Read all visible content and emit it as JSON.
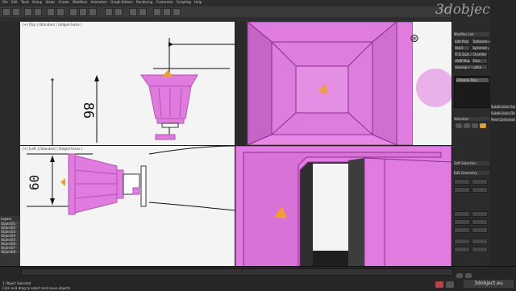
{
  "menubar": {
    "items": [
      "File",
      "Edit",
      "Tools",
      "Group",
      "Views",
      "Create",
      "Modifiers",
      "Animation",
      "Graph Editors",
      "Rendering",
      "Customize",
      "Scripting",
      "Help"
    ]
  },
  "brand": {
    "logo_text": "3dobjec"
  },
  "viewports": {
    "top_left": {
      "label": "[+] [Top ] [Standard ] [Edged Faces ]",
      "dimension": "86"
    },
    "top_right": {
      "label": ""
    },
    "bottom_left": {
      "label": "[+] [Left ] [Standard ] [Edged Faces ]",
      "dimension": "60"
    },
    "bottom_right": {
      "label": ""
    }
  },
  "command_panel": {
    "modifier_list_label": "Modifier List",
    "stack_item": "Editable Poly",
    "buttons": [
      "Edit Poly",
      "Turbosmooth",
      "Shell",
      "Symmetry",
      "FFD 2x2x2",
      "Chamfer",
      "UVW Map",
      "Slice",
      "Unwrap UVW",
      "Lathe"
    ],
    "sections": [
      "Selection",
      "Soft Selection",
      "Edit Geometry",
      "Subdivision Surface",
      "Subdivision Displacement",
      "Paint Deformation"
    ]
  },
  "layers": {
    "title": "Layers",
    "items": [
      "Object01",
      "Object02",
      "Object03",
      "Object04",
      "Object05",
      "Object06",
      "Object07",
      "Object08"
    ]
  },
  "statusbar": {
    "selected": "1 Object Selected",
    "hint": "Click and drag to select and move objects",
    "watermark": "3dobject.eu"
  },
  "colors": {
    "pink": "#e07be0",
    "pink_dark": "#b84fb8",
    "orange": "#f0a030",
    "viewport_light": "#f4f4f4"
  }
}
